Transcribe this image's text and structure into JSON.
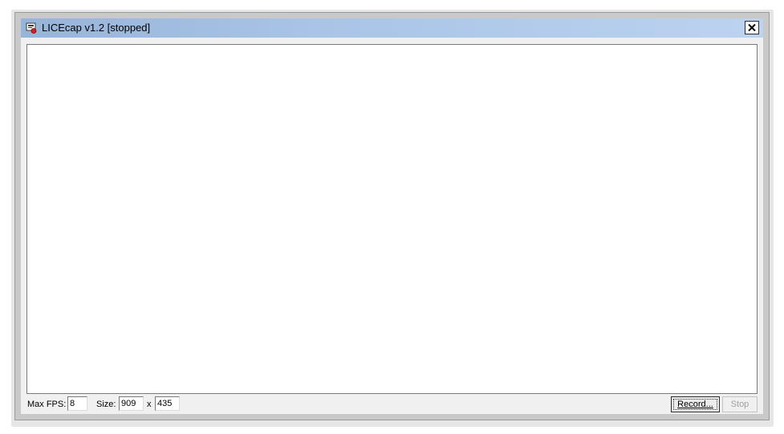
{
  "window": {
    "title": "LICEcap v1.2 [stopped]",
    "close_icon": "close-icon",
    "app_icon": "licecap-app-icon"
  },
  "controls": {
    "max_fps_label": "Max FPS:",
    "max_fps_value": "8",
    "size_label": "Size:",
    "width_value": "909",
    "size_separator": "x",
    "height_value": "435",
    "record_label": "Record...",
    "stop_label": "Stop"
  },
  "colors": {
    "titlebar_start": "#97b4d9",
    "titlebar_end": "#bcd3f0",
    "capture_background": "#ffffff",
    "disabled_text": "#a0a0a0"
  }
}
